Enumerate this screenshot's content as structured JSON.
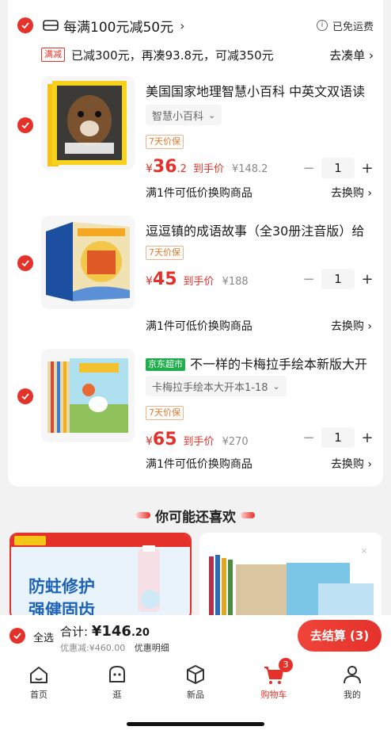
{
  "shop": {
    "promo_text": "每满100元减50元",
    "shipping": "已免运费"
  },
  "discount": {
    "tag": "满减",
    "message": "已减300元，再凑93.8元，可减350元",
    "action": "去凑单 ›"
  },
  "items": [
    {
      "title": "美国国家地理智慧小百科 中英文双语读",
      "spec": "智慧小百科",
      "badge": "7天价保",
      "price_int": "36",
      "price_dec": ".2",
      "price_label": "到手价",
      "orig_price": "¥148.2",
      "qty": "1",
      "exchange": "满1件可低价换购商品",
      "exchange_action": "去换购 ›"
    },
    {
      "title": "逗逗镇的成语故事（全30册注音版）给",
      "badge": "7天价保",
      "price_int": "45",
      "price_dec": "",
      "price_label": "到手价",
      "orig_price": "¥188",
      "qty": "1",
      "exchange": "满1件可低价换购商品",
      "exchange_action": "去换购 ›"
    },
    {
      "store_tag": "京东超市",
      "title": "不一样的卡梅拉手绘本新版大开",
      "spec": "卡梅拉手绘本大开本1-18",
      "badge": "7天价保",
      "price_int": "65",
      "price_dec": "",
      "price_label": "到手价",
      "orig_price": "¥270",
      "qty": "1",
      "exchange": "满1件可低价换购商品",
      "exchange_action": "去换购 ›"
    }
  ],
  "recommend": {
    "title": "你可能还喜欢",
    "left_text_1": "防蛀修护",
    "left_text_2": "强健固齿"
  },
  "checkout": {
    "select_all": "全选",
    "total_label": "合计:",
    "total_int": "¥146",
    "total_dec": ".20",
    "saved": "优惠减:¥460.00",
    "detail": "优惠明细",
    "pay": "去结算 (3)"
  },
  "tabs": [
    {
      "label": "首页",
      "icon": "home-icon"
    },
    {
      "label": "逛",
      "icon": "explore-icon"
    },
    {
      "label": "新品",
      "icon": "box-icon"
    },
    {
      "label": "购物车",
      "icon": "cart-icon",
      "badge": "3"
    },
    {
      "label": "我的",
      "icon": "user-icon"
    }
  ],
  "colors": {
    "accent": "#e4322b",
    "background": "#f2f2f2",
    "jd_green": "#1fae4b"
  }
}
